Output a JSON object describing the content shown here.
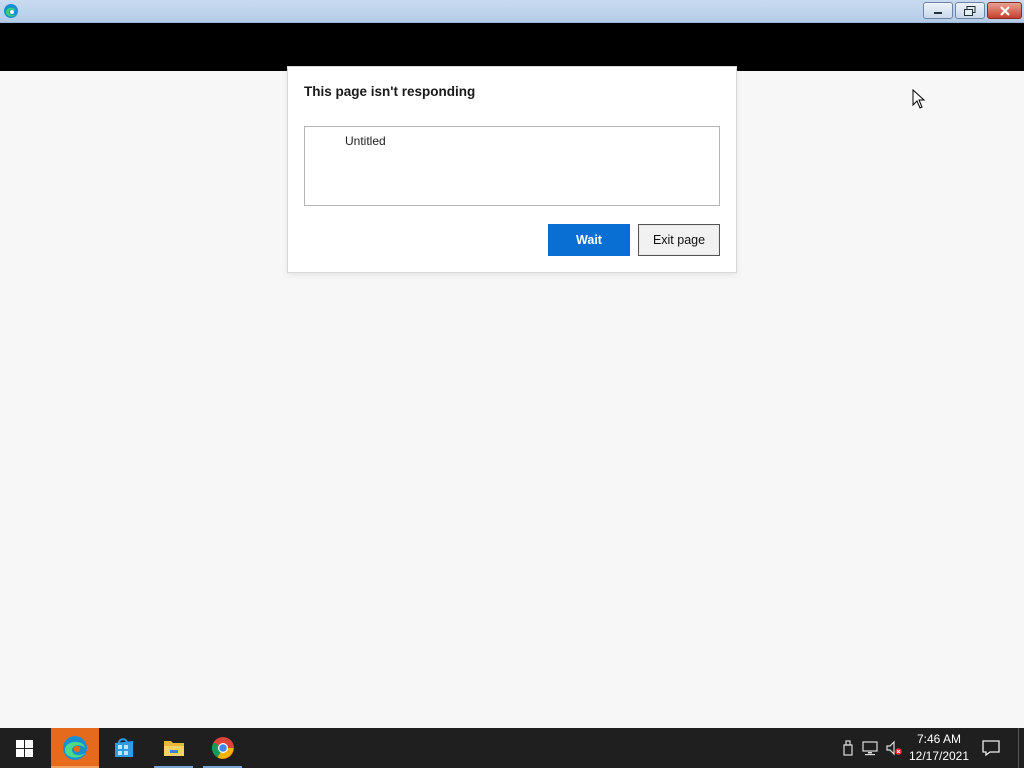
{
  "window": {
    "app_icon": "edge-icon",
    "controls": [
      "minimize-icon",
      "restore-icon",
      "close-icon"
    ]
  },
  "dialog": {
    "title": "This page isn't responding",
    "pages": [
      "Untitled"
    ],
    "buttons": {
      "wait": "Wait",
      "exit": "Exit page"
    },
    "accent_color": "#0a6fd3"
  },
  "taskbar": {
    "items": [
      "start-icon",
      "edge-icon",
      "store-icon",
      "file-explorer-icon",
      "chrome-icon"
    ],
    "tray": [
      "usb-icon",
      "network-icon",
      "volume-muted-icon"
    ],
    "clock": {
      "time": "7:46 AM",
      "date": "12/17/2021"
    }
  }
}
